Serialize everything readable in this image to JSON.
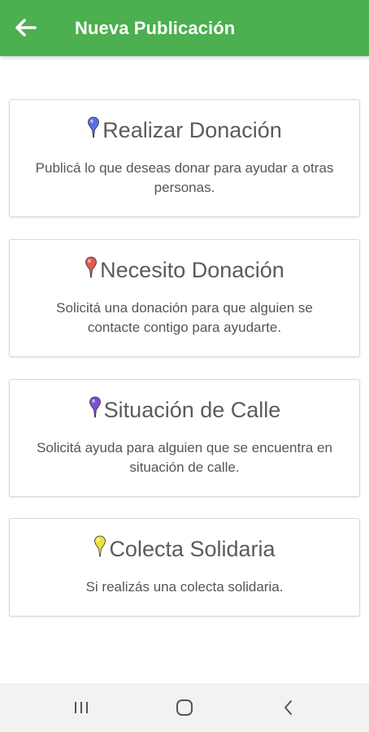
{
  "appbar": {
    "title": "Nueva Publicación",
    "background_color": "#4caf50",
    "back_icon": "arrow-left-icon"
  },
  "cards": [
    {
      "title": "Realizar Donación",
      "description": "Publicá lo que deseas donar para ayudar a otras personas.",
      "pin_color": "#5b6fe0"
    },
    {
      "title": "Necesito Donación",
      "description": "Solicitá una donación para que alguien se contacte contigo para ayudarte.",
      "pin_color": "#e05a4f"
    },
    {
      "title": "Situación de Calle",
      "description": "Solicitá ayuda para alguien que se encuentra en situación de calle.",
      "pin_color": "#7a4fd6"
    },
    {
      "title": "Colecta Solidaria",
      "description": "Si realizás una colecta solidaria.",
      "pin_color": "#f0e040"
    }
  ],
  "system_nav": {
    "recents_icon": "recents-icon",
    "home_icon": "home-icon",
    "back_icon": "back-chevron-icon"
  }
}
